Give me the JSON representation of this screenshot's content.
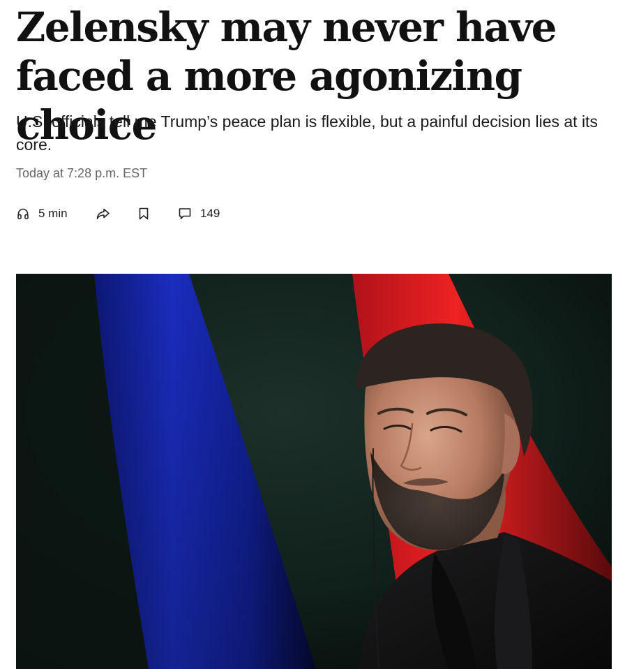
{
  "article": {
    "headline": "Zelensky may never have faced a more agonizing choice",
    "dek": "U.S. officials tell me Trump’s peace plan is flexible, but a painful decision lies at its core.",
    "timestamp": "Today at 7:28 p.m. EST"
  },
  "toolbar": {
    "listen_duration": "5 min",
    "listen_icon": "headphones-icon",
    "share_icon": "share-arrow-icon",
    "save_icon": "bookmark-icon",
    "comments_icon": "comment-bubble-icon",
    "comment_count": "149"
  },
  "hero_image": {
    "subject": "zelensky-portrait",
    "colors": {
      "background": "#0c1714",
      "flag_blue": "#1a2fd6",
      "flag_red": "#e01e1e",
      "jacket": "#121212"
    }
  }
}
